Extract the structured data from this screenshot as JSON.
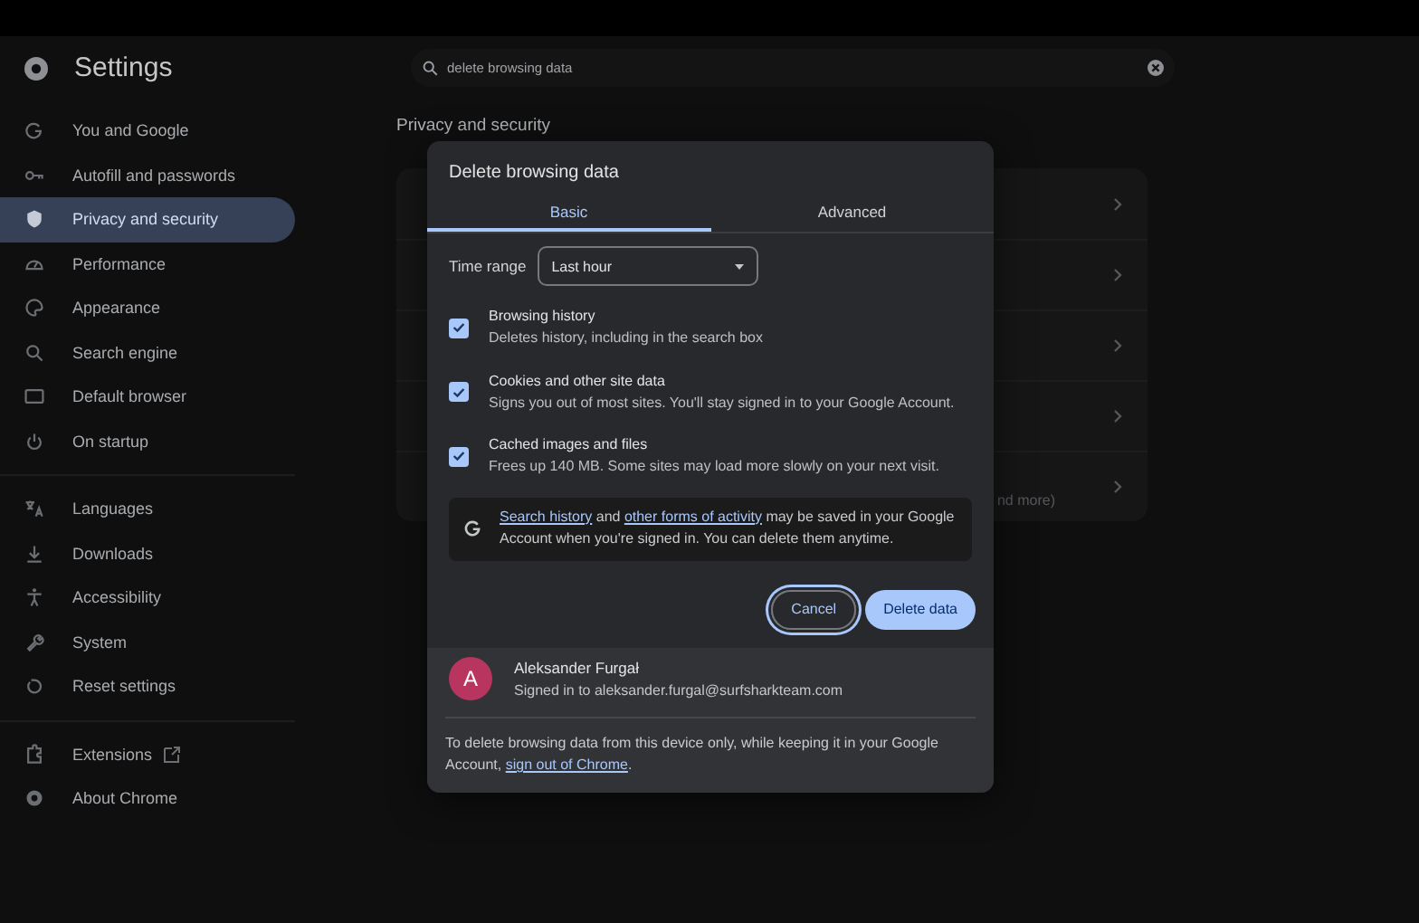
{
  "header": {
    "title": "Settings"
  },
  "search": {
    "value": "delete browsing data"
  },
  "sidebar": {
    "groups": [
      {
        "items": [
          {
            "label": "You and Google",
            "selected": false
          },
          {
            "label": "Autofill and passwords",
            "selected": false
          },
          {
            "label": "Privacy and security",
            "selected": true
          },
          {
            "label": "Performance",
            "selected": false
          },
          {
            "label": "Appearance",
            "selected": false
          },
          {
            "label": "Search engine",
            "selected": false
          },
          {
            "label": "Default browser",
            "selected": false
          },
          {
            "label": "On startup",
            "selected": false
          }
        ]
      },
      {
        "items": [
          {
            "label": "Languages",
            "selected": false
          },
          {
            "label": "Downloads",
            "selected": false
          },
          {
            "label": "Accessibility",
            "selected": false
          },
          {
            "label": "System",
            "selected": false
          },
          {
            "label": "Reset settings",
            "selected": false
          }
        ]
      },
      {
        "items": [
          {
            "label": "Extensions",
            "selected": false,
            "external": true
          },
          {
            "label": "About Chrome",
            "selected": false,
            "external": false
          }
        ]
      }
    ]
  },
  "main": {
    "heading": "Privacy and security",
    "row_fragment": "nd more)"
  },
  "dialog": {
    "title": "Delete browsing data",
    "tabs": [
      {
        "label": "Basic",
        "selected": true
      },
      {
        "label": "Advanced",
        "selected": false
      }
    ],
    "time_range": {
      "label": "Time range",
      "value": "Last hour"
    },
    "options": [
      {
        "title": "Browsing history",
        "description": "Deletes history, including in the search box",
        "checked": true
      },
      {
        "title": "Cookies and other site data",
        "description": "Signs you out of most sites. You'll stay signed in to your Google Account.",
        "checked": true
      },
      {
        "title": "Cached images and files",
        "description": "Frees up 140 MB. Some sites may load more slowly on your next visit.",
        "checked": true
      }
    ],
    "notice": [
      {
        "kind": "link",
        "text": "Search history"
      },
      {
        "kind": "text",
        "text": " and "
      },
      {
        "kind": "link",
        "text": "other forms of activity"
      },
      {
        "kind": "text",
        "text": " may be saved in your Google Account when you're signed in. You can delete them anytime."
      }
    ],
    "buttons": [
      {
        "label": "Cancel",
        "kind": "outlined",
        "focused": true
      },
      {
        "label": "Delete data",
        "kind": "filled",
        "focused": false
      }
    ],
    "account": {
      "initial": "A",
      "color": "#b83560",
      "name": "Aleksander Furgał",
      "email": "Signed in to aleksander.furgal@surfsharkteam.com"
    },
    "footer": [
      {
        "kind": "text",
        "text": "To delete browsing data from this device only, while keeping it in your Google Account, "
      },
      {
        "kind": "link",
        "text": "sign out of Chrome"
      },
      {
        "kind": "text",
        "text": "."
      }
    ]
  }
}
